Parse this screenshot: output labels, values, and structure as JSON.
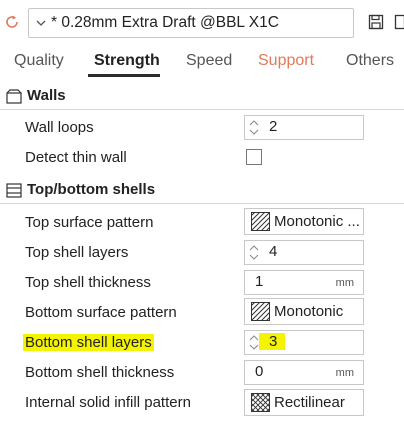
{
  "header": {
    "preset_name": "* 0.28mm Extra Draft @BBL X1C",
    "icons": [
      "refresh-icon",
      "chevron-down-icon",
      "save-icon"
    ]
  },
  "tabs": [
    {
      "label": "Quality",
      "active": false
    },
    {
      "label": "Strength",
      "active": true
    },
    {
      "label": "Speed",
      "active": false
    },
    {
      "label": "Support",
      "active": false,
      "color": "#e07a5a"
    },
    {
      "label": "Others",
      "active": false
    }
  ],
  "walls": {
    "title": "Walls",
    "wall_loops": {
      "label": "Wall loops",
      "value": "2"
    },
    "detect_thin_wall": {
      "label": "Detect thin wall",
      "checked": false
    }
  },
  "shells": {
    "title": "Top/bottom shells",
    "top_surface_pattern": {
      "label": "Top surface pattern",
      "value": "Monotonic ..."
    },
    "top_shell_layers": {
      "label": "Top shell layers",
      "value": "4"
    },
    "top_shell_thickness": {
      "label": "Top shell thickness",
      "value": "1",
      "unit": "mm"
    },
    "bottom_surface_pattern": {
      "label": "Bottom surface pattern",
      "value": "Monotonic"
    },
    "bottom_shell_layers": {
      "label": "Bottom shell layers",
      "value": "3",
      "highlight_color": "#f4f400"
    },
    "bottom_shell_thickness": {
      "label": "Bottom shell thickness",
      "value": "0",
      "unit": "mm"
    },
    "internal_solid_infill_pattern": {
      "label": "Internal solid infill pattern",
      "value": "Rectilinear"
    }
  }
}
